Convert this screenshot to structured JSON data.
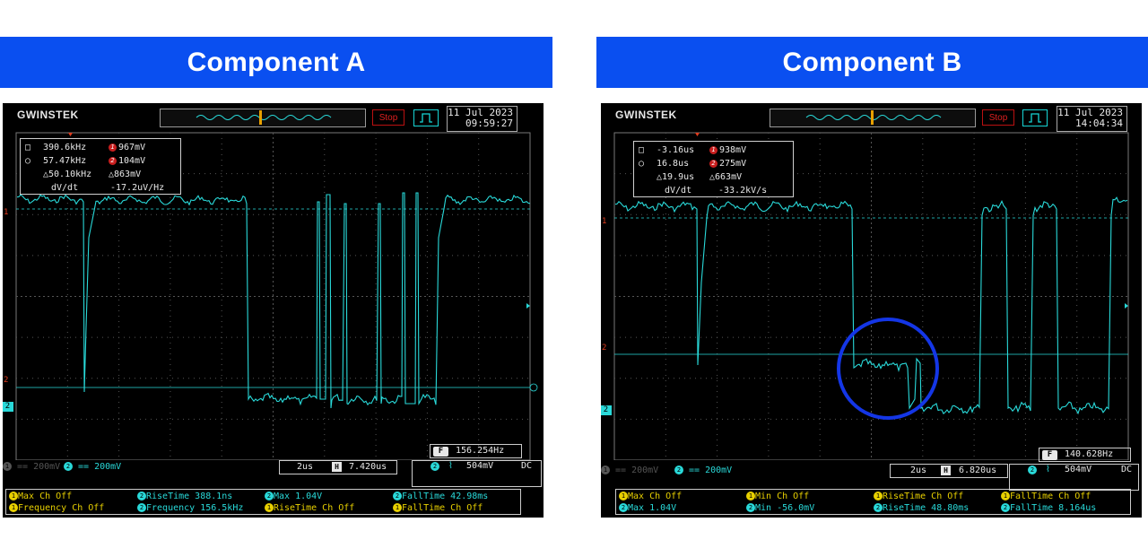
{
  "panels": [
    {
      "header": "Component A",
      "brand": "GWINSTEK",
      "stop_label": "Stop",
      "date": "11 Jul 2023",
      "time": "09:59:27",
      "measure": {
        "r1a": "390.6kHz",
        "r1b": "967mV",
        "r2a": "57.47kHz",
        "r2b": "104mV",
        "r3a": "△50.10kHz",
        "r3b": "△863mV",
        "r4a": "dV/dt",
        "r4b": "-17.2uV/Hz"
      },
      "freq": "156.254Hz",
      "ch1_scale": "200mV",
      "ch2_scale": "200mV",
      "timebase": "2us",
      "hpos": "7.420us",
      "trig_level": "504mV",
      "coupling": "DC",
      "footer": [
        {
          "ch": "1",
          "text": "Max Ch Off"
        },
        {
          "ch": "2",
          "text": "RiseTime 388.1ns"
        },
        {
          "ch": "2",
          "text": "Max 1.04V"
        },
        {
          "ch": "2",
          "text": "FallTime 42.98ms"
        },
        {
          "ch": "1",
          "text": "Frequency Ch Off"
        },
        {
          "ch": "2",
          "text": "Frequency 156.5kHz"
        },
        {
          "ch": "1",
          "text": "RiseTime Ch Off"
        },
        {
          "ch": "1",
          "text": "FallTime Ch Off"
        }
      ]
    },
    {
      "header": "Component B",
      "brand": "GWINSTEK",
      "stop_label": "Stop",
      "date": "11 Jul 2023",
      "time": "14:04:34",
      "measure": {
        "r1a": "-3.16us",
        "r1b": "938mV",
        "r2a": "16.8us",
        "r2b": "275mV",
        "r3a": "△19.9us",
        "r3b": "△663mV",
        "r4a": "dV/dt",
        "r4b": "-33.2kV/s"
      },
      "freq": "140.628Hz",
      "ch1_scale": "200mV",
      "ch2_scale": "200mV",
      "timebase": "2us",
      "hpos": "6.820us",
      "trig_level": "504mV",
      "coupling": "DC",
      "footer": [
        {
          "ch": "1",
          "text": "Max Ch Off"
        },
        {
          "ch": "1",
          "text": "Min Ch Off"
        },
        {
          "ch": "1",
          "text": "RiseTime Ch Off"
        },
        {
          "ch": "1",
          "text": "FallTime Ch Off"
        },
        {
          "ch": "2",
          "text": "Max 1.04V"
        },
        {
          "ch": "2",
          "text": "Min -56.0mV"
        },
        {
          "ch": "2",
          "text": "RiseTime 48.80ms"
        },
        {
          "ch": "2",
          "text": "FallTime 8.164us"
        }
      ]
    }
  ],
  "colors": {
    "header_bg": "#0a4ff0",
    "trace": "#29d9d9",
    "highlight": "#1436e6"
  }
}
